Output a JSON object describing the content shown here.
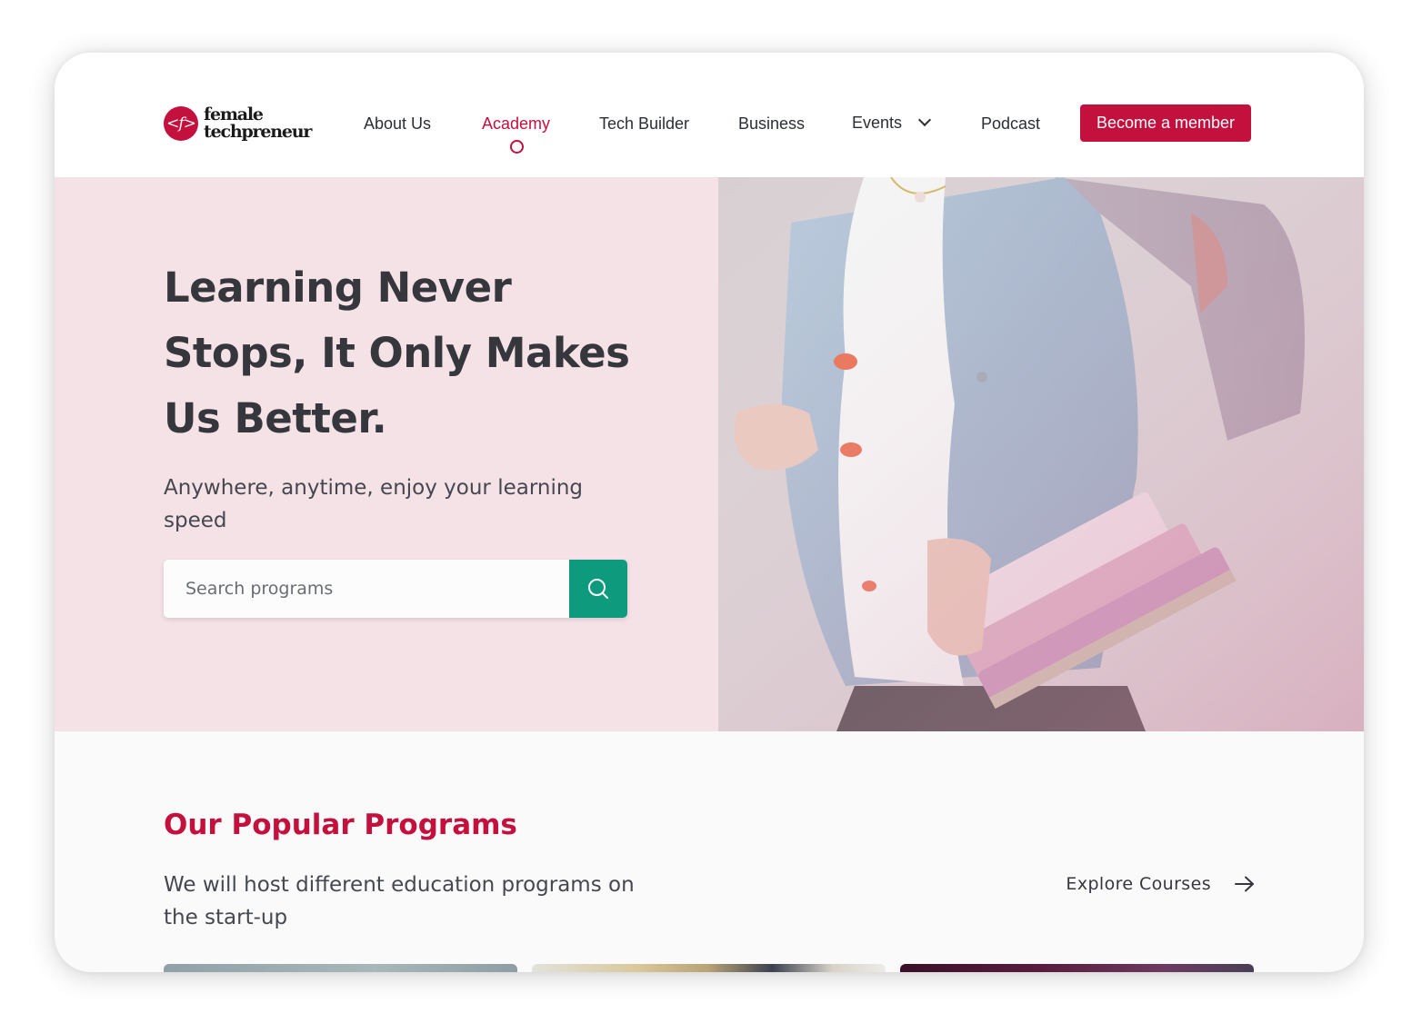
{
  "brand": {
    "logo_mark": "<f>",
    "line1": "female",
    "line2": "techpreneur"
  },
  "nav": {
    "items": [
      {
        "label": "About Us"
      },
      {
        "label": "Academy",
        "active": true
      },
      {
        "label": "Tech Builder"
      },
      {
        "label": "Business"
      },
      {
        "label": "Events",
        "has_dropdown": true
      },
      {
        "label": "Podcast"
      }
    ],
    "cta_label": "Become a member"
  },
  "hero": {
    "title": "Learning Never Stops, It Only Makes Us Better.",
    "subtitle": "Anywhere, anytime, enjoy your learning speed",
    "search_placeholder": "Search programs",
    "search_value": "",
    "search_icon": "search-icon",
    "photo_icon": "student-with-books-photo"
  },
  "programs": {
    "title": "Our Popular Programs",
    "subtitle": "We will host different education programs on the start-up",
    "explore_label": "Explore Courses",
    "explore_icon": "arrow-right-icon"
  },
  "colors": {
    "brand": "#c4103d",
    "hero_bg": "#f5e2e7",
    "search_button": "#0e9b7d",
    "text_dark": "#35373d"
  }
}
